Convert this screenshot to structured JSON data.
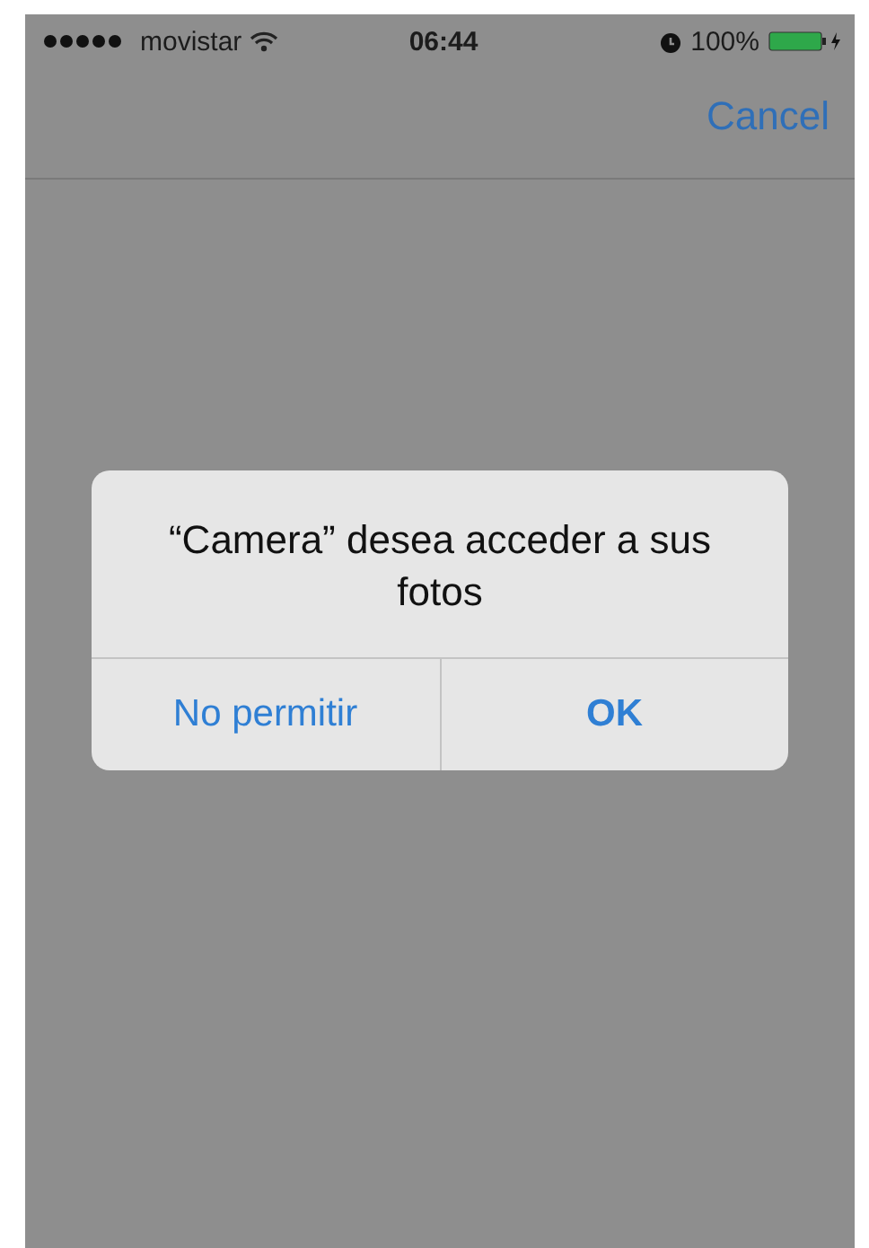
{
  "status_bar": {
    "carrier": "movistar",
    "time": "06:44",
    "battery": "100%"
  },
  "nav_bar": {
    "action": "Cancel"
  },
  "alert": {
    "message": "“Camera” desea acceder a sus fotos",
    "buttons": [
      {
        "label": "No permitir",
        "kind": "normal"
      },
      {
        "label": "OK",
        "kind": "preferred"
      }
    ]
  }
}
